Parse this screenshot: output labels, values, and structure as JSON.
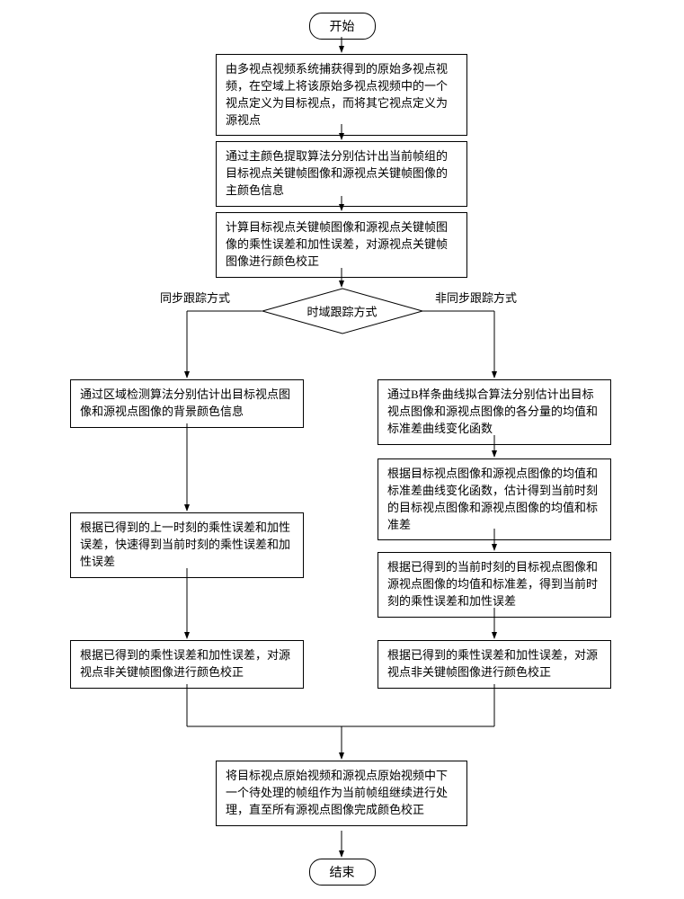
{
  "terminals": {
    "start": "开始",
    "end": "结束"
  },
  "steps": {
    "s1": "由多视点视频系统捕获得到的原始多视点视频，在空域上将该原始多视点视频中的一个视点定义为目标视点，而将其它视点定义为源视点",
    "s2": "通过主颜色提取算法分别估计出当前帧组的目标视点关键帧图像和源视点关键帧图像的主颜色信息",
    "s3": "计算目标视点关键帧图像和源视点关键帧图像的乘性误差和加性误差，对源视点关键帧图像进行颜色校正",
    "leftA": "通过区域检测算法分别估计出目标视点图像和源视点图像的背景颜色信息",
    "leftB": "根据已得到的上一时刻的乘性误差和加性误差，快速得到当前时刻的乘性误差和加性误差",
    "leftC": "根据已得到的乘性误差和加性误差，对源视点非关键帧图像进行颜色校正",
    "rightA": "通过B样条曲线拟合算法分别估计出目标视点图像和源视点图像的各分量的均值和标准差曲线变化函数",
    "rightB": "根据目标视点图像和源视点图像的均值和标准差曲线变化函数，估计得到当前时刻的目标视点图像和源视点图像的均值和标准差",
    "rightC": "根据已得到的当前时刻的目标视点图像和源视点图像的均值和标准差，得到当前时刻的乘性误差和加性误差",
    "rightD": "根据已得到的乘性误差和加性误差，对源视点非关键帧图像进行颜色校正",
    "merge": "将目标视点原始视频和源视点原始视频中下一个待处理的帧组作为当前帧组继续进行处理，直至所有源视点图像完成颜色校正"
  },
  "decision": {
    "label": "时域跟踪方式",
    "left": "同步跟踪方式",
    "right": "非同步跟踪方式"
  }
}
